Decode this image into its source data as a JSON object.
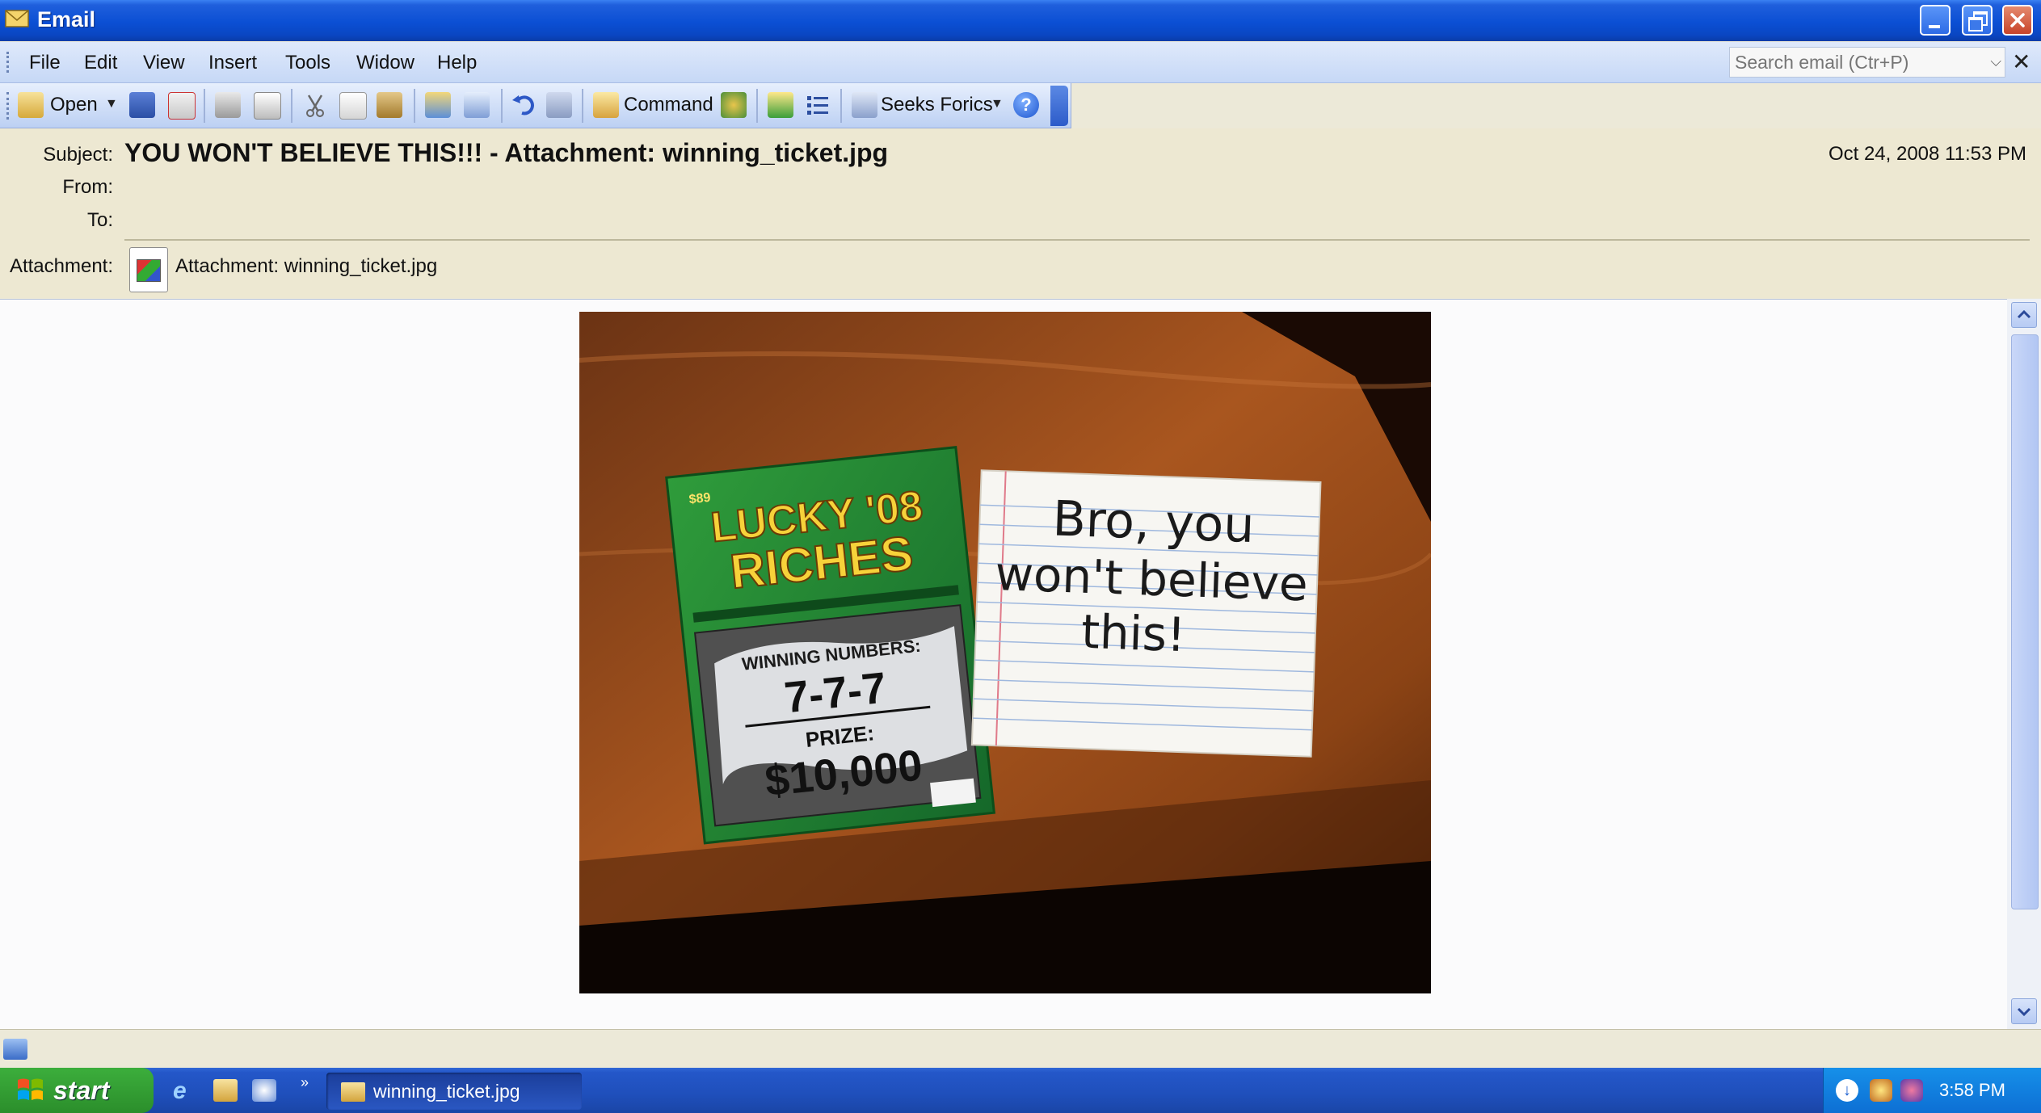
{
  "window": {
    "title": "Email"
  },
  "menu": {
    "items": [
      "File",
      "Edit",
      "View",
      "Insert",
      "Tools",
      "Widow",
      "Help"
    ]
  },
  "search": {
    "placeholder": "Search email (Ctr+P)"
  },
  "toolbar": {
    "open_label": "Open",
    "command_label": "Command",
    "seeks_label": "Seeks Forics"
  },
  "email": {
    "subject_label": "Subject:",
    "subject": "YOU WON'T BELIEVE THIS!!! - Attachment: winning_ticket.jpg",
    "date": "Oct 24, 2008 11:53 PM",
    "from_label": "From:",
    "to_label": "To:",
    "attachment_label": "Attachment:",
    "attachment_name": "Attachment: winning_ticket.jpg"
  },
  "photo": {
    "ticket": {
      "price": "$89",
      "title_line1": "LUCKY '08",
      "title_line2": "RICHES",
      "numbers_label": "WINNING NUMBERS:",
      "numbers": "7-7-7",
      "prize_label": "PRIZE:",
      "prize": "$10,000"
    },
    "note": {
      "line1": "Bro, you",
      "line2": "won't believe",
      "line3": "this!"
    }
  },
  "taskbar": {
    "start_label": "start",
    "task_label": "winning_ticket.jpg",
    "clock": "3:58 PM"
  }
}
